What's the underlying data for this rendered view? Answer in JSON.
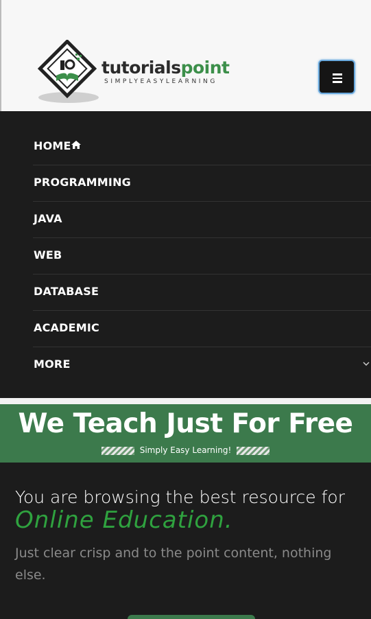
{
  "header": {
    "logo_name": "tutorialspoint",
    "logo_part1": "tutorials",
    "logo_part2": "point",
    "tagline": "SIMPLYEASYLEARNING",
    "menu_button_icon": "hamburger-icon"
  },
  "nav": {
    "items": [
      {
        "label": "HOME",
        "icon": "home-icon"
      },
      {
        "label": "PROGRAMMING"
      },
      {
        "label": "JAVA"
      },
      {
        "label": "WEB"
      },
      {
        "label": "DATABASE"
      },
      {
        "label": "ACADEMIC"
      },
      {
        "label": "MORE",
        "icon": "chevron-down-icon"
      }
    ]
  },
  "banner": {
    "title": "We Teach Just For Free",
    "subtitle": "Simply Easy Learning!"
  },
  "hero": {
    "line1": "You are browsing the best resource for",
    "line2": "Online Education.",
    "line3": "Just clear crisp and to the point content, nothing else."
  },
  "colors": {
    "brand_green": "#3c7a4c",
    "accent_green": "#2fa23f",
    "nav_bg": "#1c1c1c"
  }
}
